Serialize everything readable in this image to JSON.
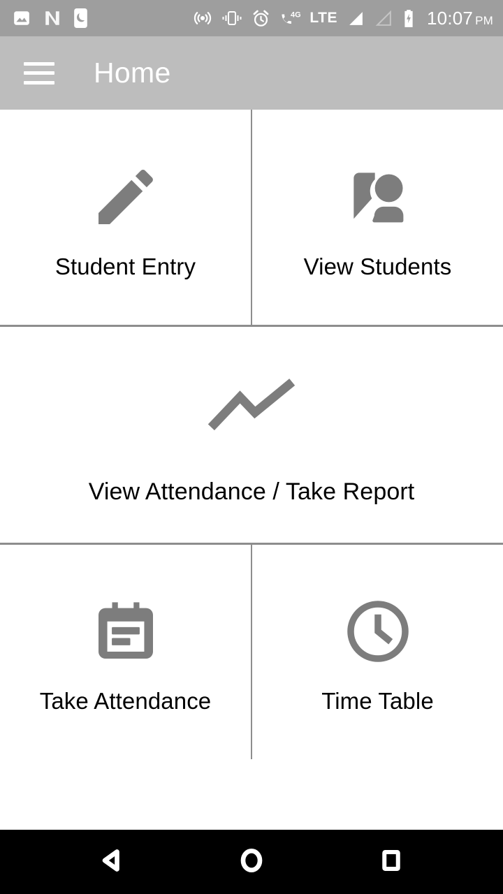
{
  "status_bar": {
    "background_color": "#9e9e9e",
    "icon_color": "#ffffff",
    "left_icons": [
      {
        "name": "image-icon",
        "label": "Screenshot / Image"
      },
      {
        "name": "android-n-icon",
        "label": "Android N"
      },
      {
        "name": "moon-do-not-disturb-icon",
        "label": "Do Not Disturb"
      }
    ],
    "right_icons": [
      {
        "name": "hotspot-icon",
        "label": "Hotspot"
      },
      {
        "name": "vibrate-icon",
        "label": "Vibrate"
      },
      {
        "name": "alarm-icon",
        "label": "Alarm"
      },
      {
        "name": "call-4g-icon",
        "label": "4G Call"
      }
    ],
    "network_label": "LTE",
    "signal_primary": "signal-bars-full-icon",
    "signal_secondary": "signal-bars-empty-icon",
    "battery": "battery-charging-icon",
    "time": "10:07",
    "time_period": "PM"
  },
  "app_bar": {
    "background_color": "#bdbdbd",
    "menu_icon": "hamburger-menu-icon",
    "title": "Home",
    "title_color": "#ffffff"
  },
  "home_grid": {
    "icon_color": "#7d7d7d",
    "divider_color": "#8d8d8d",
    "label_color": "#000000",
    "rows": [
      {
        "cells": [
          {
            "label": "Student Entry",
            "icon": "pencil-edit-icon"
          },
          {
            "label": "View Students",
            "icon": "account-box-people-icon"
          }
        ]
      },
      {
        "cells": [
          {
            "label": "View Attendance / Take Report",
            "icon": "trending-line-chart-icon"
          }
        ]
      },
      {
        "cells": [
          {
            "label": "Take Attendance",
            "icon": "calendar-event-note-icon"
          },
          {
            "label": "Time Table",
            "icon": "clock-icon"
          }
        ]
      }
    ]
  },
  "nav_bar": {
    "background_color": "#000000",
    "buttons": [
      {
        "name": "back-button",
        "icon": "triangle-back-icon"
      },
      {
        "name": "home-button",
        "icon": "circle-home-icon"
      },
      {
        "name": "recents-button",
        "icon": "square-recents-icon"
      }
    ]
  }
}
